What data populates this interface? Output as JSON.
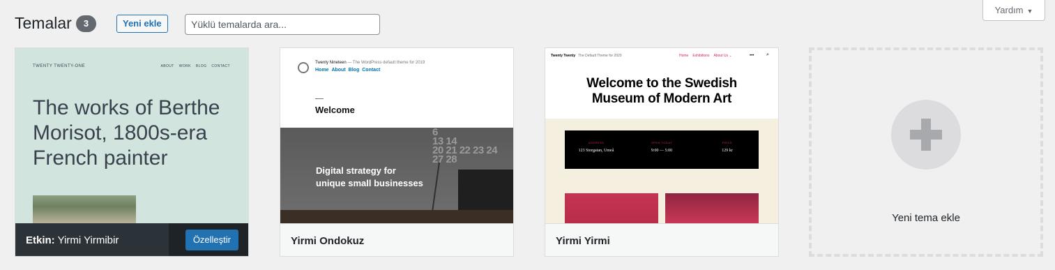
{
  "header": {
    "title": "Temalar",
    "count": "3",
    "add_new_label": "Yeni ekle",
    "search_placeholder": "Yüklü temalarda ara...",
    "help_label": "Yardım"
  },
  "themes": [
    {
      "active_prefix": "Etkin:",
      "name": "Yirmi Yirmibir",
      "customize_label": "Özelleştir",
      "preview": {
        "site_title": "TWENTY TWENTY-ONE",
        "nav": [
          "ABOUT",
          "WORK",
          "BLOG",
          "CONTACT"
        ],
        "headline": "The works of Berthe Morisot, 1800s-era French painter"
      }
    },
    {
      "name": "Yirmi Ondokuz",
      "preview": {
        "site_title": "Twenty Nineteen",
        "tagline": "— The WordPress default theme for 2019",
        "nav": [
          "Home",
          "About",
          "Blog",
          "Contact"
        ],
        "welcome": "Welcome",
        "hero_line1": "Digital strategy for",
        "hero_line2": "unique small businesses",
        "calendar_digits": "6\n13 14\n20 21 22 23 24\n27 28"
      }
    },
    {
      "name": "Yirmi Yirmi",
      "preview": {
        "site_title": "Twenty Twenty",
        "tagline": "The Default Theme for 2020",
        "nav": [
          "Home",
          "Exhibitions",
          "About Us ⌄"
        ],
        "menu_label": "•••",
        "headline_line1": "Welcome to the Swedish",
        "headline_line2": "Museum of Modern Art",
        "info": [
          {
            "label": "ADDRESS",
            "value": "123 Storgatan, Umeå"
          },
          {
            "label": "OPEN TODAY",
            "value": "9:00 — 5:00"
          },
          {
            "label": "PRICE",
            "value": "129 kr"
          }
        ]
      }
    }
  ],
  "add_new_theme": {
    "label": "Yeni tema ekle"
  },
  "colors": {
    "accent": "#2271b1",
    "badge": "#646970",
    "active_bar": "#1d2327",
    "tt1_bg": "#d1e4dd",
    "t20_accent": "#cd2653"
  }
}
